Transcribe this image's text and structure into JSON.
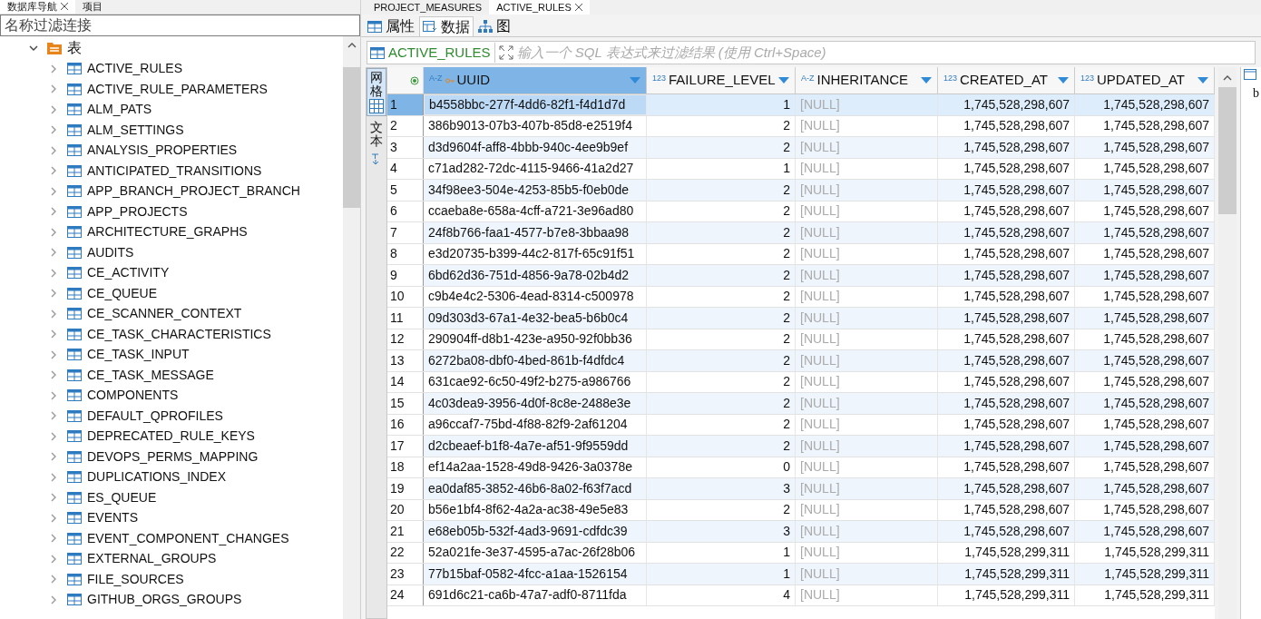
{
  "left_tabs": [
    {
      "label": "数据库导航",
      "selected": true,
      "closable": true
    },
    {
      "label": "项目",
      "selected": false,
      "closable": false
    }
  ],
  "editor_tabs": [
    {
      "label": "PROJECT_MEASURES",
      "selected": false,
      "closable": false
    },
    {
      "label": "ACTIVE_RULES",
      "selected": true,
      "closable": true
    }
  ],
  "navigator": {
    "filter": {
      "placeholder": "名称过滤连接"
    },
    "tree": [
      {
        "label": "表",
        "expanded": true,
        "children": [
          {
            "label": "ACTIVE_RULES",
            "expanded": false
          },
          {
            "label": "ACTIVE_RULE_PARAMETERS",
            "expanded": false
          },
          {
            "label": "ALM_PATS",
            "expanded": false
          },
          {
            "label": "ALM_SETTINGS",
            "expanded": false
          },
          {
            "label": "ANALYSIS_PROPERTIES",
            "expanded": false
          },
          {
            "label": "ANTICIPATED_TRANSITIONS",
            "expanded": false
          },
          {
            "label": "APP_BRANCH_PROJECT_BRANCH",
            "expanded": false
          },
          {
            "label": "APP_PROJECTS",
            "expanded": false
          },
          {
            "label": "ARCHITECTURE_GRAPHS",
            "expanded": false
          },
          {
            "label": "AUDITS",
            "expanded": false
          },
          {
            "label": "CE_ACTIVITY",
            "expanded": false
          },
          {
            "label": "CE_QUEUE",
            "expanded": false
          },
          {
            "label": "CE_SCANNER_CONTEXT",
            "expanded": false
          },
          {
            "label": "CE_TASK_CHARACTERISTICS",
            "expanded": false
          },
          {
            "label": "CE_TASK_INPUT",
            "expanded": false
          },
          {
            "label": "CE_TASK_MESSAGE",
            "expanded": false
          },
          {
            "label": "COMPONENTS",
            "expanded": false
          },
          {
            "label": "DEFAULT_QPROFILES",
            "expanded": false
          },
          {
            "label": "DEPRECATED_RULE_KEYS",
            "expanded": false
          },
          {
            "label": "DEVOPS_PERMS_MAPPING",
            "expanded": false
          },
          {
            "label": "DUPLICATIONS_INDEX",
            "expanded": false
          },
          {
            "label": "ES_QUEUE",
            "expanded": false
          },
          {
            "label": "EVENTS",
            "expanded": false
          },
          {
            "label": "EVENT_COMPONENT_CHANGES",
            "expanded": false
          },
          {
            "label": "EXTERNAL_GROUPS",
            "expanded": false
          },
          {
            "label": "FILE_SOURCES",
            "expanded": false
          },
          {
            "label": "GITHUB_ORGS_GROUPS",
            "expanded": false
          }
        ]
      }
    ]
  },
  "sub_tabs": [
    {
      "label": "属性",
      "selected": false,
      "kind": "table"
    },
    {
      "label": "数据",
      "selected": true,
      "kind": "data"
    },
    {
      "label": "图",
      "selected": false,
      "kind": "diagram"
    }
  ],
  "filter_bar": {
    "table": "ACTIVE_RULES",
    "placeholder": "输入一个 SQL 表达式来过滤结果 (使用 Ctrl+Space)"
  },
  "side_toolbar": [
    {
      "label": "网格",
      "selected": true
    },
    {
      "label": "文本",
      "selected": false
    }
  ],
  "table": {
    "columns": [
      {
        "label": "UUID",
        "type_label": "A-Z",
        "key": true,
        "selected": true,
        "kind": "text"
      },
      {
        "label": "FAILURE_LEVEL",
        "type_label": "123",
        "key": false,
        "selected": false,
        "kind": "number"
      },
      {
        "label": "INHERITANCE",
        "type_label": "A-Z",
        "key": false,
        "selected": false,
        "kind": "text"
      },
      {
        "label": "CREATED_AT",
        "type_label": "123",
        "key": false,
        "selected": false,
        "kind": "number"
      },
      {
        "label": "UPDATED_AT",
        "type_label": "123",
        "key": false,
        "selected": false,
        "kind": "number"
      }
    ],
    "rows": [
      {
        "n": "1",
        "selected": true,
        "cells": [
          "b4558bbc-277f-4dd6-82f1-f4d1d7d",
          "1",
          "[NULL]",
          "1,745,528,298,607",
          "1,745,528,298,607"
        ]
      },
      {
        "n": "2",
        "selected": false,
        "cells": [
          "386b9013-07b3-407b-85d8-e2519f4",
          "2",
          "[NULL]",
          "1,745,528,298,607",
          "1,745,528,298,607"
        ]
      },
      {
        "n": "3",
        "selected": false,
        "cells": [
          "d3d9604f-aff8-4bbb-940c-4ee9b9ef",
          "2",
          "[NULL]",
          "1,745,528,298,607",
          "1,745,528,298,607"
        ]
      },
      {
        "n": "4",
        "selected": false,
        "cells": [
          "c71ad282-72dc-4115-9466-41a2d27",
          "1",
          "[NULL]",
          "1,745,528,298,607",
          "1,745,528,298,607"
        ]
      },
      {
        "n": "5",
        "selected": false,
        "cells": [
          "34f98ee3-504e-4253-85b5-f0eb0de",
          "2",
          "[NULL]",
          "1,745,528,298,607",
          "1,745,528,298,607"
        ]
      },
      {
        "n": "6",
        "selected": false,
        "cells": [
          "ccaeba8e-658a-4cff-a721-3e96ad80",
          "2",
          "[NULL]",
          "1,745,528,298,607",
          "1,745,528,298,607"
        ]
      },
      {
        "n": "7",
        "selected": false,
        "cells": [
          "24f8b766-faa1-4577-b7e8-3bbaa98",
          "2",
          "[NULL]",
          "1,745,528,298,607",
          "1,745,528,298,607"
        ]
      },
      {
        "n": "8",
        "selected": false,
        "cells": [
          "e3d20735-b399-44c2-817f-65c91f51",
          "2",
          "[NULL]",
          "1,745,528,298,607",
          "1,745,528,298,607"
        ]
      },
      {
        "n": "9",
        "selected": false,
        "cells": [
          "6bd62d36-751d-4856-9a78-02b4d2",
          "2",
          "[NULL]",
          "1,745,528,298,607",
          "1,745,528,298,607"
        ]
      },
      {
        "n": "10",
        "selected": false,
        "cells": [
          "c9b4e4c2-5306-4ead-8314-c500978",
          "2",
          "[NULL]",
          "1,745,528,298,607",
          "1,745,528,298,607"
        ]
      },
      {
        "n": "11",
        "selected": false,
        "cells": [
          "09d303d3-67a1-4e32-bea5-b6b0c4",
          "2",
          "[NULL]",
          "1,745,528,298,607",
          "1,745,528,298,607"
        ]
      },
      {
        "n": "12",
        "selected": false,
        "cells": [
          "290904ff-d8b1-423e-a950-92f0bb36",
          "2",
          "[NULL]",
          "1,745,528,298,607",
          "1,745,528,298,607"
        ]
      },
      {
        "n": "13",
        "selected": false,
        "cells": [
          "6272ba08-dbf0-4bed-861b-f4dfdc4",
          "2",
          "[NULL]",
          "1,745,528,298,607",
          "1,745,528,298,607"
        ]
      },
      {
        "n": "14",
        "selected": false,
        "cells": [
          "631cae92-6c50-49f2-b275-a986766",
          "2",
          "[NULL]",
          "1,745,528,298,607",
          "1,745,528,298,607"
        ]
      },
      {
        "n": "15",
        "selected": false,
        "cells": [
          "4c03dea9-3956-4d0f-8c8e-2488e3e",
          "2",
          "[NULL]",
          "1,745,528,298,607",
          "1,745,528,298,607"
        ]
      },
      {
        "n": "16",
        "selected": false,
        "cells": [
          "a96ccaf7-75bd-4f88-82f9-2af61204",
          "2",
          "[NULL]",
          "1,745,528,298,607",
          "1,745,528,298,607"
        ]
      },
      {
        "n": "17",
        "selected": false,
        "cells": [
          "d2cbeaef-b1f8-4a7e-af51-9f9559dd",
          "2",
          "[NULL]",
          "1,745,528,298,607",
          "1,745,528,298,607"
        ]
      },
      {
        "n": "18",
        "selected": false,
        "cells": [
          "ef14a2aa-1528-49d8-9426-3a0378e",
          "0",
          "[NULL]",
          "1,745,528,298,607",
          "1,745,528,298,607"
        ]
      },
      {
        "n": "19",
        "selected": false,
        "cells": [
          "ea0daf85-3852-46b6-8a02-f63f7acd",
          "3",
          "[NULL]",
          "1,745,528,298,607",
          "1,745,528,298,607"
        ]
      },
      {
        "n": "20",
        "selected": false,
        "cells": [
          "b56e1bf4-8f62-4a2a-ac38-49e5e83",
          "2",
          "[NULL]",
          "1,745,528,298,607",
          "1,745,528,298,607"
        ]
      },
      {
        "n": "21",
        "selected": false,
        "cells": [
          "e68eb05b-532f-4ad3-9691-cdfdc39",
          "3",
          "[NULL]",
          "1,745,528,298,607",
          "1,745,528,298,607"
        ]
      },
      {
        "n": "22",
        "selected": false,
        "cells": [
          "52a021fe-3e37-4595-a7ac-26f28b06",
          "1",
          "[NULL]",
          "1,745,528,299,311",
          "1,745,528,299,311"
        ]
      },
      {
        "n": "23",
        "selected": false,
        "cells": [
          "77b15baf-0582-4fcc-a1aa-1526154",
          "1",
          "[NULL]",
          "1,745,528,299,311",
          "1,745,528,299,311"
        ]
      },
      {
        "n": "24",
        "selected": false,
        "cells": [
          "691d6c21-ca6b-47a7-adf0-8711fda",
          "4",
          "[NULL]",
          "1,745,528,299,311",
          "1,745,528,299,311"
        ]
      }
    ]
  },
  "right_panel": {
    "text": "b"
  }
}
